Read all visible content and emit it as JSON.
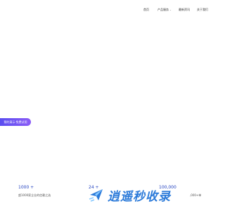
{
  "nav": {
    "items": [
      {
        "label": "首页"
      },
      {
        "label": "产品服务",
        "has_dropdown": true
      },
      {
        "label": "最新资讯"
      },
      {
        "label": "关于我们"
      }
    ]
  },
  "hero": {
    "cta_label": "预约演示·免费试用"
  },
  "stats": [
    {
      "value": "1000 +",
      "caption": "超1000家企业的信赖之选"
    },
    {
      "value": "24 +",
      "caption": ""
    },
    {
      "value": "100,000",
      "caption": ",000+单"
    }
  ],
  "watermark": {
    "text": "逍遥秒收录",
    "colors": {
      "primary": "#1a6fd6",
      "accent": "#7cc4ff"
    }
  }
}
